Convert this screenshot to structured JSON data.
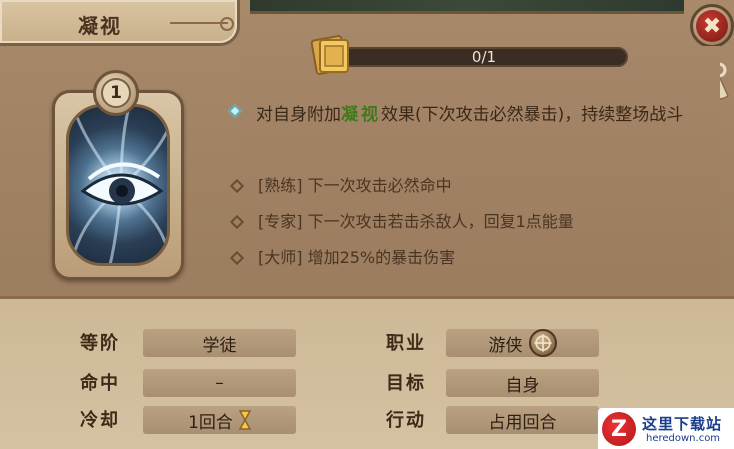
{
  "window": {
    "title": "凝视",
    "close_label": "✖"
  },
  "skill": {
    "level": "1",
    "progress_text": "0/1",
    "progress_fraction": 0.0,
    "icon": "eye-icon",
    "description_before": "对自身附加",
    "description_highlight": "凝视",
    "description_after": "效果(下次攻击必然暴击)，持续整场战斗",
    "tiers": [
      "[熟练] 下一次攻击必然命中",
      "[专家] 下一次攻击若击杀敌人，回复1点能量",
      "[大师] 增加25%的暴击伤害"
    ]
  },
  "stats": {
    "rank_label": "等阶",
    "rank_value": "学徒",
    "hit_label": "命中",
    "hit_value": "–",
    "cooldown_label": "冷却",
    "cooldown_value": "1回合",
    "class_label": "职业",
    "class_value": "游侠",
    "target_label": "目标",
    "target_value": "自身",
    "action_label": "行动",
    "action_value": "占用回合"
  },
  "watermark": {
    "logo_letter": "Z",
    "title": "这里下载站",
    "url": "heredown.com"
  },
  "colors": {
    "highlight": "#3f7a1c",
    "close_red": "#c33a30"
  }
}
